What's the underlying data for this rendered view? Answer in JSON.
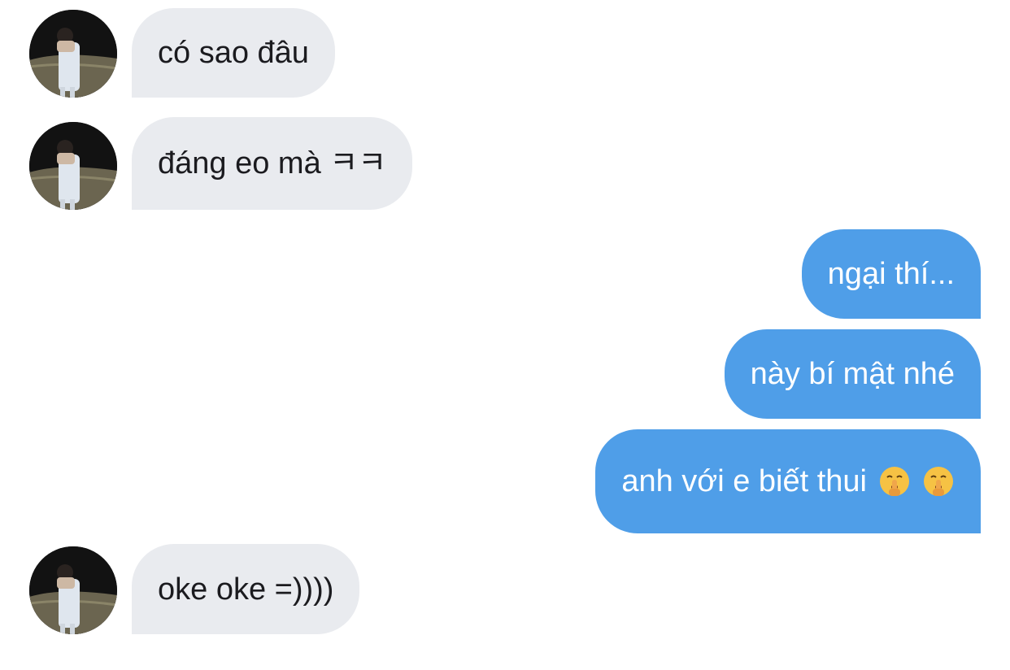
{
  "chat": {
    "messages": [
      {
        "from": "them",
        "text": "có sao đâu"
      },
      {
        "from": "them",
        "text": "đáng eo mà ㅋㅋ"
      },
      {
        "from": "me",
        "text": "ngại thí..."
      },
      {
        "from": "me",
        "text": "này bí mật nhé"
      },
      {
        "from": "me",
        "text": "anh với e biết thui",
        "emojis": [
          "shushing-face",
          "shushing-face"
        ]
      },
      {
        "from": "them",
        "text": "oke oke =))))"
      }
    ]
  },
  "colors": {
    "incoming_bubble": "#e9ebef",
    "outgoing_bubble": "#4f9ee8",
    "incoming_text": "#1b1b1f",
    "outgoing_text": "#ffffff"
  }
}
